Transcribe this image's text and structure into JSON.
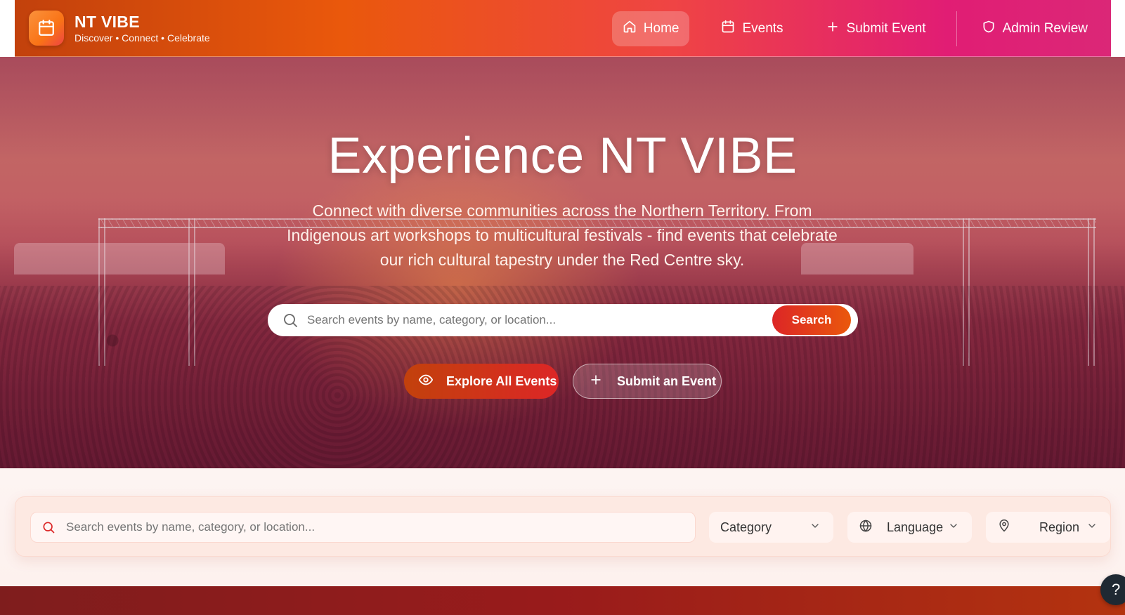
{
  "brand": {
    "title": "NT VIBE",
    "tagline": "Discover • Connect • Celebrate",
    "logo_icon": "calendar-icon"
  },
  "nav": {
    "items": [
      {
        "label": "Home",
        "icon": "home-icon",
        "active": true
      },
      {
        "label": "Events",
        "icon": "calendar-icon",
        "active": false
      },
      {
        "label": "Submit Event",
        "icon": "plus-icon",
        "active": false
      },
      {
        "label": "Admin Review",
        "icon": "shield-icon",
        "active": false
      }
    ]
  },
  "hero": {
    "title": "Experience NT VIBE",
    "description": "Connect with diverse communities across the Northern Territory. From Indigenous art workshops to multicultural festivals - find events that celebrate our rich cultural tapestry under the Red Centre sky.",
    "search": {
      "placeholder": "Search events by name, category, or location...",
      "button_label": "Search"
    },
    "explore_label": "Explore All Events",
    "submit_label": "Submit an Event"
  },
  "filters": {
    "search_placeholder": "Search events by name, category, or location...",
    "category": "Category",
    "language": "Language",
    "region": "Region"
  },
  "help": {
    "label": "?"
  },
  "colors": {
    "brand_orange": "#ea580c",
    "brand_red": "#dc2626",
    "brand_pink": "#db2777",
    "footer_red": "#991b1b"
  }
}
